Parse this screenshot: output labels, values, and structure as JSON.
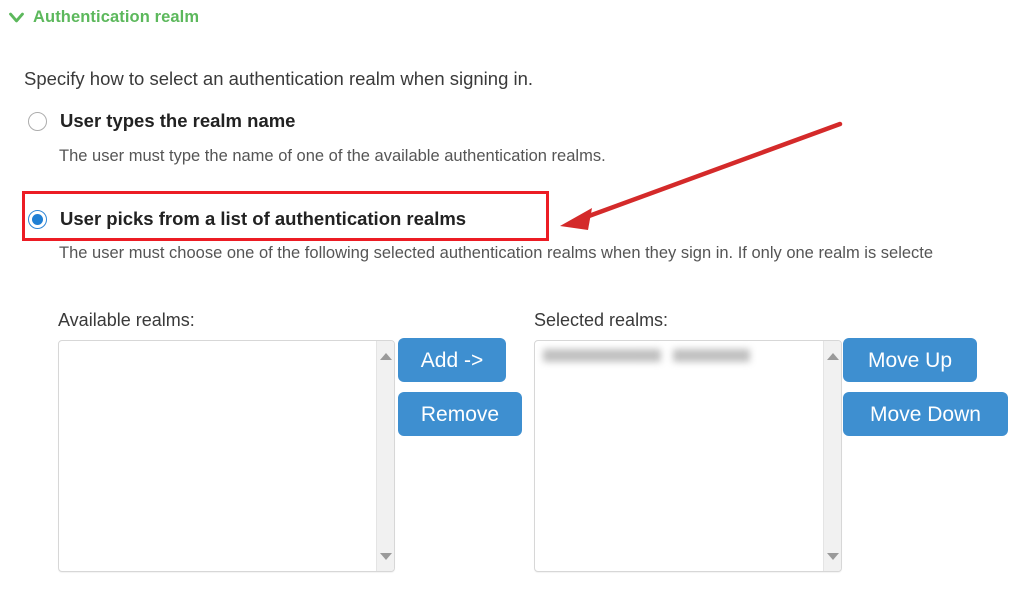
{
  "section": {
    "title": "Authentication realm",
    "chevron_icon": "chevron-down-icon",
    "accent_color": "#5cb85c",
    "expanded": true
  },
  "intro": {
    "text": "Specify how to select an authentication realm when signing in."
  },
  "options": [
    {
      "id": "type-realm-name",
      "label": "User types the realm name",
      "description": "The user must type the name of one of the available authentication realms.",
      "selected": false
    },
    {
      "id": "pick-from-list",
      "label": "User picks from a list of authentication realms",
      "description": "The user must choose one of the following selected authentication realms when they sign in. If only one realm is selecte",
      "selected": true
    }
  ],
  "annotation": {
    "highlight_color": "#ec1c24",
    "arrow_icon": "arrow-pointing-left-icon",
    "box_target": "pick-from-list"
  },
  "picker": {
    "available": {
      "label": "Available realms:",
      "items": [],
      "scrollbar": {
        "up_icon": "scroll-up-arrow-icon",
        "down_icon": "scroll-down-arrow-icon"
      }
    },
    "selected": {
      "label": "Selected realms:",
      "items": [
        {
          "redacted": true,
          "chips": 2
        }
      ],
      "scrollbar": {
        "up_icon": "scroll-up-arrow-icon",
        "down_icon": "scroll-down-arrow-icon"
      }
    },
    "buttons": {
      "add": "Add ->",
      "remove": "Remove",
      "move_up": "Move Up",
      "move_down": "Move Down",
      "color": "#3e8fd0"
    }
  }
}
